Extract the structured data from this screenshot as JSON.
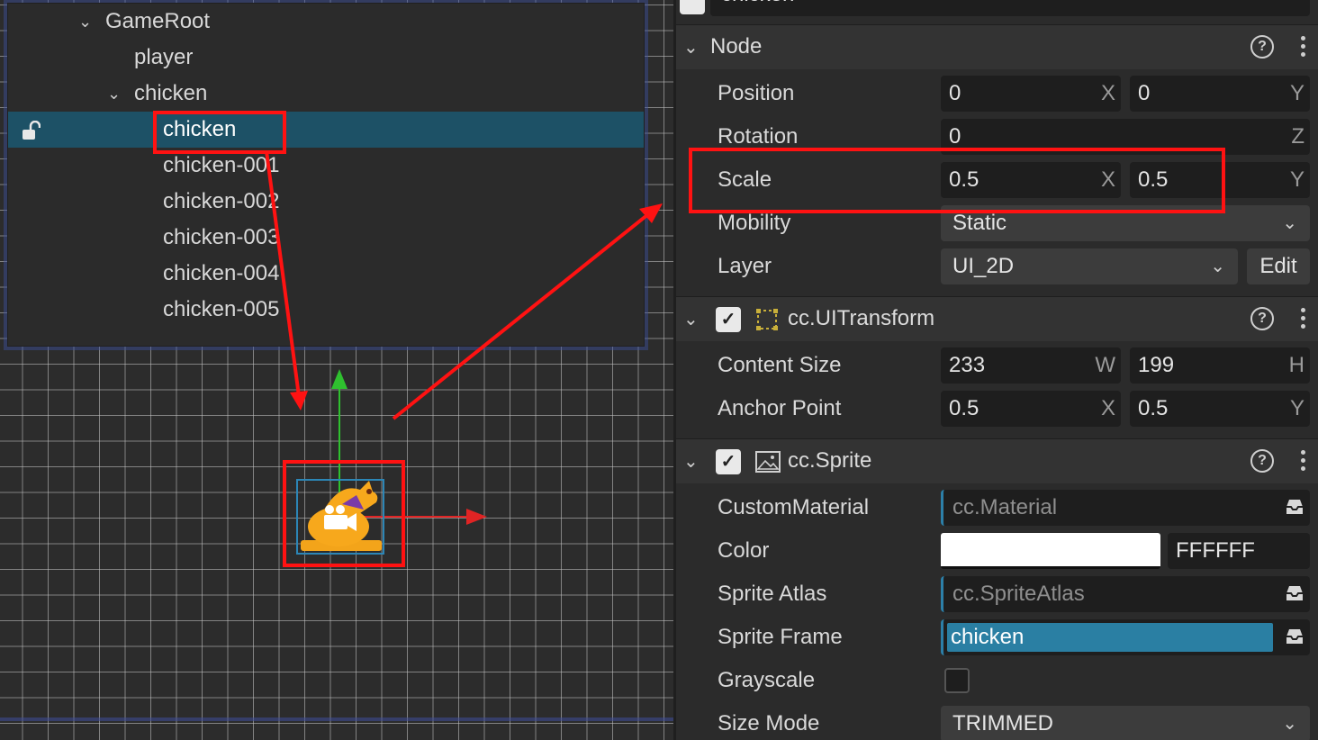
{
  "hierarchy": {
    "items": [
      {
        "label": "GameRoot",
        "expanded": true
      },
      {
        "label": "player"
      },
      {
        "label": "chicken",
        "expanded": true
      },
      {
        "label": "chicken",
        "selected": true
      },
      {
        "label": "chicken-001"
      },
      {
        "label": "chicken-002"
      },
      {
        "label": "chicken-003"
      },
      {
        "label": "chicken-004"
      },
      {
        "label": "chicken-005"
      }
    ]
  },
  "inspector": {
    "node_name": "chicken",
    "node_section": {
      "title": "Node",
      "position": {
        "label": "Position",
        "x": "0",
        "y": "0",
        "x_axis": "X",
        "y_axis": "Y"
      },
      "rotation": {
        "label": "Rotation",
        "z": "0",
        "z_axis": "Z"
      },
      "scale": {
        "label": "Scale",
        "x": "0.5",
        "y": "0.5",
        "x_axis": "X",
        "y_axis": "Y"
      },
      "mobility": {
        "label": "Mobility",
        "value": "Static"
      },
      "layer": {
        "label": "Layer",
        "value": "UI_2D",
        "edit_label": "Edit"
      }
    },
    "uitransform": {
      "title": "cc.UITransform",
      "enabled": true,
      "content_size": {
        "label": "Content Size",
        "w": "233",
        "h": "199",
        "w_axis": "W",
        "h_axis": "H"
      },
      "anchor_point": {
        "label": "Anchor Point",
        "x": "0.5",
        "y": "0.5",
        "x_axis": "X",
        "y_axis": "Y"
      }
    },
    "sprite": {
      "title": "cc.Sprite",
      "enabled": true,
      "custom_material": {
        "label": "CustomMaterial",
        "value": "cc.Material"
      },
      "color": {
        "label": "Color",
        "hex": "FFFFFF",
        "swatch": "#FFFFFF"
      },
      "sprite_atlas": {
        "label": "Sprite Atlas",
        "value": "cc.SpriteAtlas"
      },
      "sprite_frame": {
        "label": "Sprite Frame",
        "value": "chicken"
      },
      "grayscale": {
        "label": "Grayscale",
        "checked": false
      },
      "size_mode": {
        "label": "Size Mode",
        "value": "TRIMMED"
      }
    }
  },
  "icons": {
    "help": "?",
    "check": "✓",
    "chevron_down": "⌄"
  },
  "colors": {
    "selection": "#1d5166",
    "annotation": "#ff1212",
    "sprite_frame_bg": "#2a7fa3",
    "gizmo_y": "#2fc02f",
    "gizmo_x": "#e02424"
  }
}
